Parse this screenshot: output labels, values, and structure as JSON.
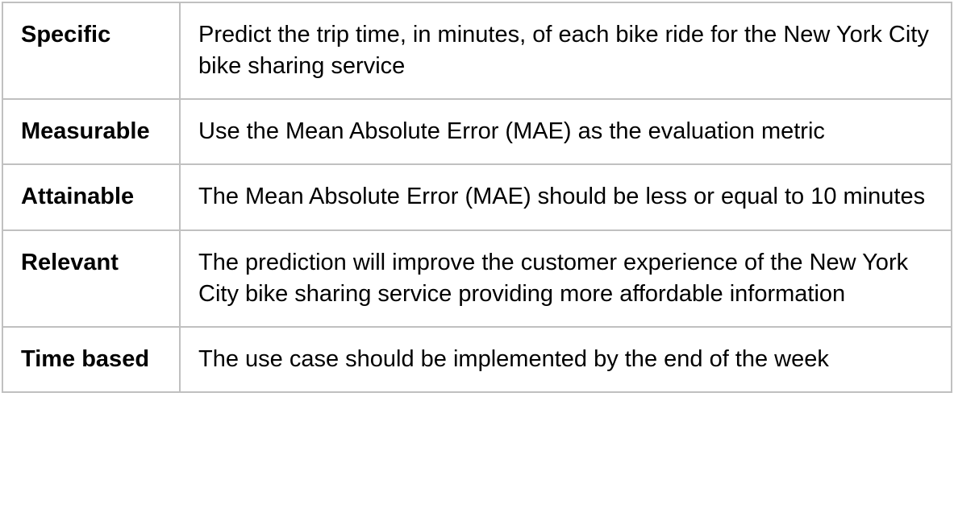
{
  "table": {
    "rows": [
      {
        "label": "Specific",
        "value": "Predict the trip time, in minutes, of each bike ride for the New York City bike sharing service"
      },
      {
        "label": "Measurable",
        "value": "Use the Mean Absolute Error (MAE) as the evaluation metric"
      },
      {
        "label": "Attainable",
        "value": "The Mean Absolute Error (MAE) should be less or equal to 10 minutes"
      },
      {
        "label": "Relevant",
        "value": "The prediction will improve the customer experience of the New York City bike sharing service providing more affordable information"
      },
      {
        "label": "Time based",
        "value": "The use case should be implemented by the end of the week"
      }
    ]
  }
}
